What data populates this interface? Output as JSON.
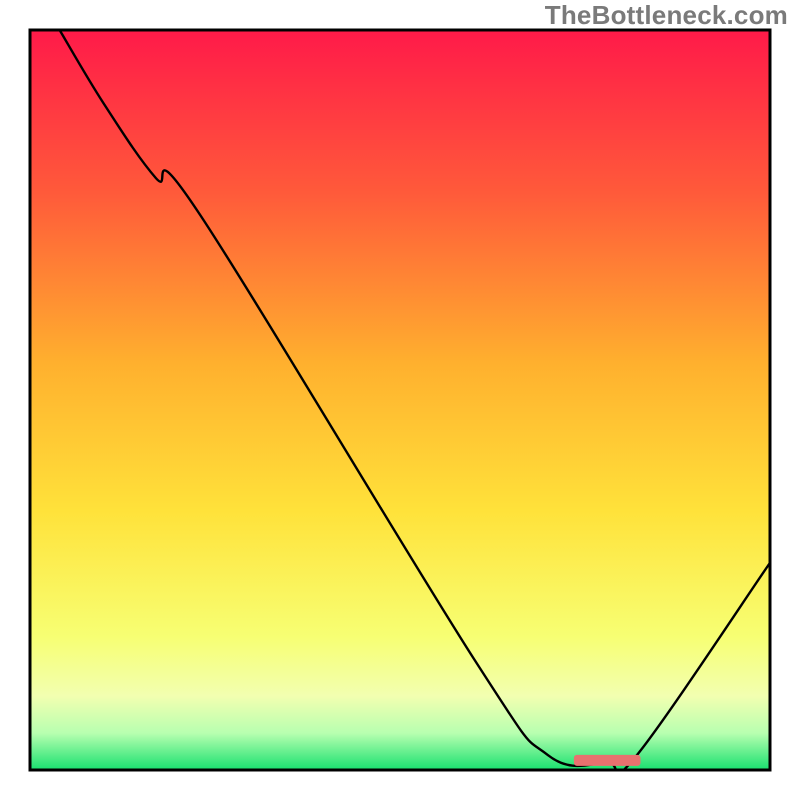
{
  "watermark": "TheBottleneck.com",
  "chart_data": {
    "type": "line",
    "title": "",
    "xlabel": "",
    "ylabel": "",
    "xlim": [
      0,
      100
    ],
    "ylim": [
      0,
      100
    ],
    "background_gradient": {
      "top": "#ff1a49",
      "mid_upper": "#ff8c2e",
      "mid": "#ffe23a",
      "mid_lower": "#f7ff73",
      "band": "#d9ff9b",
      "bottom": "#18e06f"
    },
    "series": [
      {
        "name": "bottleneck-curve",
        "x": [
          4,
          10,
          17,
          23,
          60,
          70,
          78,
          82,
          100
        ],
        "y": [
          100,
          90,
          80,
          75,
          15,
          2,
          1,
          2,
          28
        ],
        "stroke": "#000000",
        "width": 2.4
      }
    ],
    "marker": {
      "name": "optimal-range",
      "x_center": 78,
      "y": 1.3,
      "width": 9,
      "color": "#e8716f",
      "rx": 3
    },
    "axes": {
      "frame_stroke": "#000000",
      "frame_width": 3
    }
  }
}
